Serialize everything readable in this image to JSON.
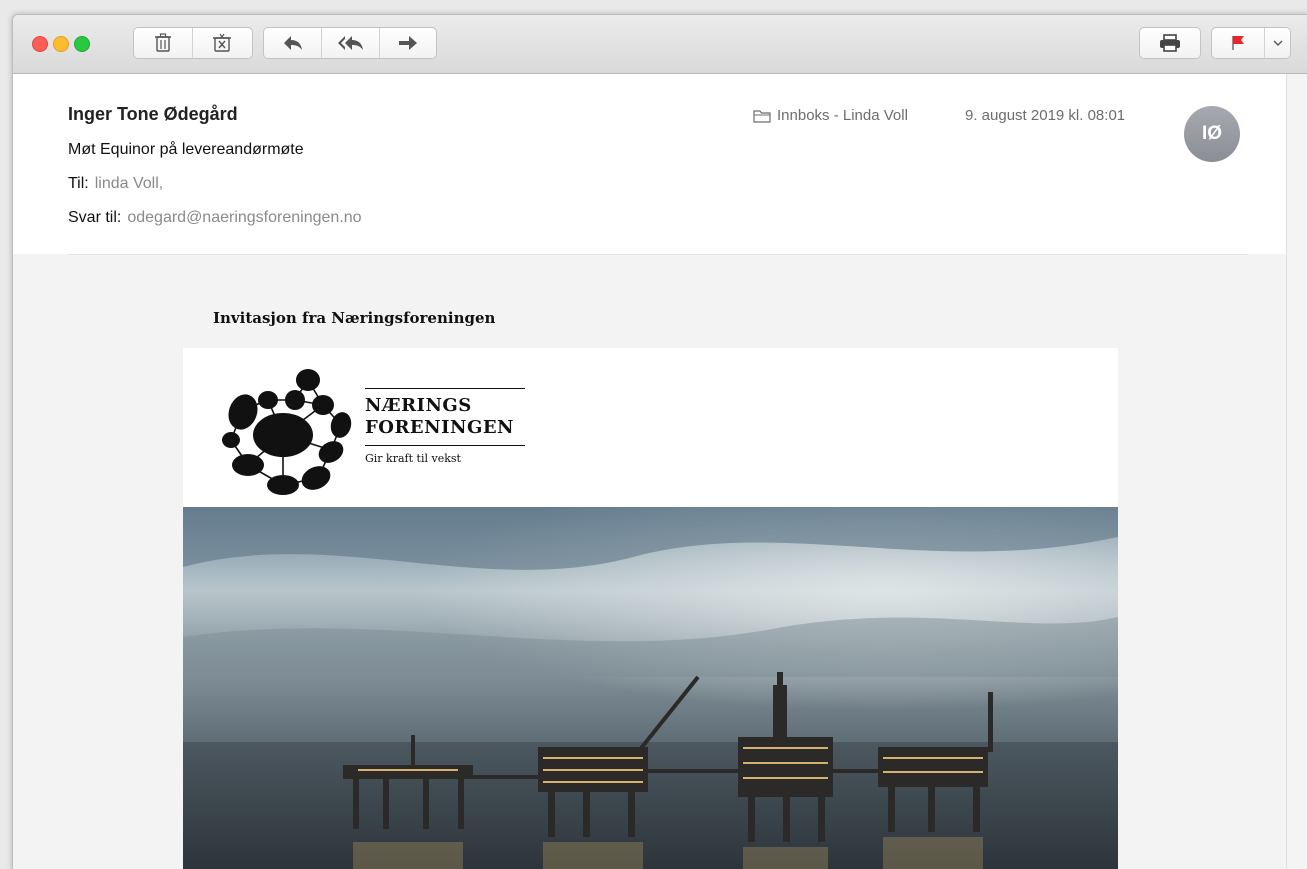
{
  "toolbar": {
    "buttons": [
      "trash-icon",
      "junk-icon",
      "reply-icon",
      "reply-all-icon",
      "forward-icon",
      "print-icon",
      "flag-icon",
      "chevron-down-icon"
    ],
    "flag_color": "#e8262a"
  },
  "message": {
    "sender": "Inger Tone Ødegård",
    "subject": "Møt Equinor på levereandørmøte",
    "to_label": "Til:",
    "to_value": "linda Voll,",
    "reply_label": "Svar til:",
    "reply_value": "odegard@naeringsforeningen.no",
    "mailbox": "Innboks - Linda Voll",
    "date": "9. august 2019 kl. 08:01",
    "avatar_initials": "IØ"
  },
  "body": {
    "invitation": "Invitasjon fra Næringsforeningen",
    "logo": {
      "line1": "NÆRINGS",
      "line2": "FORENINGEN",
      "tagline": "Gir kraft til vekst"
    }
  }
}
